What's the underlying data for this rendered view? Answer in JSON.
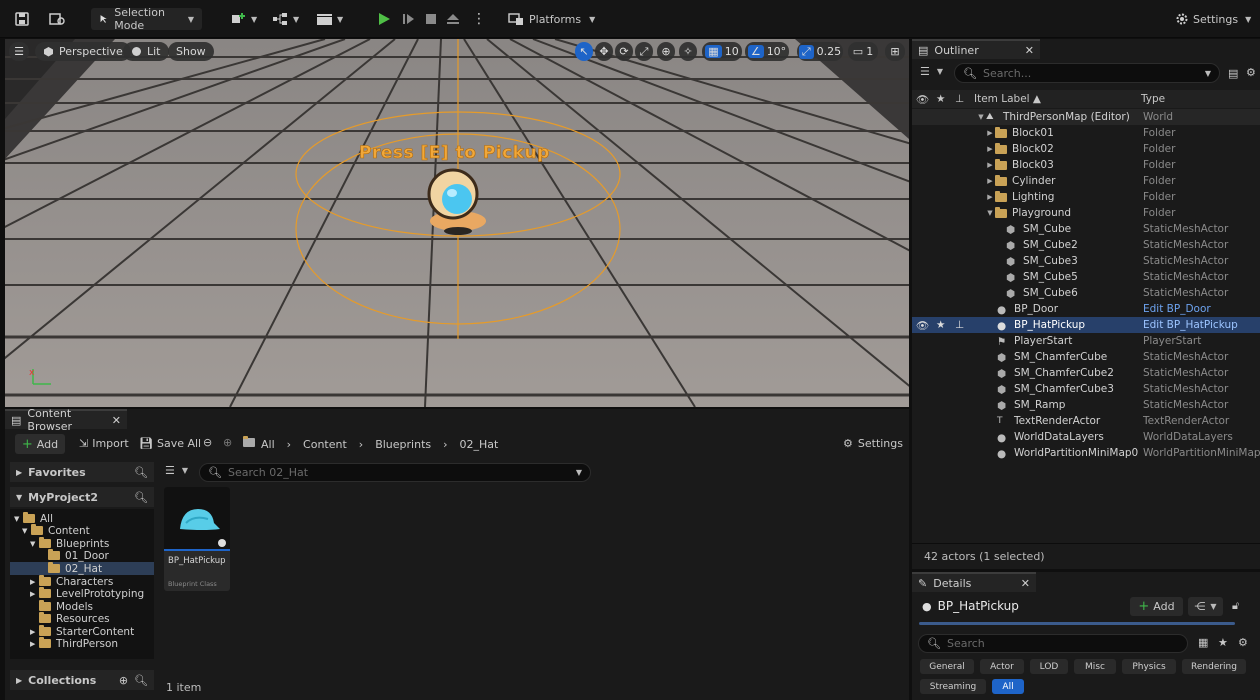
{
  "toolbar": {
    "selection_mode": "Selection Mode",
    "platforms": "Platforms",
    "settings": "Settings"
  },
  "viewport": {
    "perspective": "Perspective",
    "lit": "Lit",
    "show": "Show",
    "grid_snap": "10",
    "rot_snap": "10°",
    "scale_snap": "0.25",
    "camera_speed": "1",
    "world_text": "Press [E] to Pickup"
  },
  "outliner": {
    "tab": "Outliner",
    "search_placeholder": "Search...",
    "col_label": "Item Label",
    "col_type": "Type",
    "rows": [
      {
        "label": "ThirdPersonMap (Editor)",
        "type": "World"
      },
      {
        "label": "Block01",
        "type": "Folder"
      },
      {
        "label": "Block02",
        "type": "Folder"
      },
      {
        "label": "Block03",
        "type": "Folder"
      },
      {
        "label": "Cylinder",
        "type": "Folder"
      },
      {
        "label": "Lighting",
        "type": "Folder"
      },
      {
        "label": "Playground",
        "type": "Folder"
      },
      {
        "label": "SM_Cube",
        "type": "StaticMeshActor"
      },
      {
        "label": "SM_Cube2",
        "type": "StaticMeshActor"
      },
      {
        "label": "SM_Cube3",
        "type": "StaticMeshActor"
      },
      {
        "label": "SM_Cube5",
        "type": "StaticMeshActor"
      },
      {
        "label": "SM_Cube6",
        "type": "StaticMeshActor"
      },
      {
        "label": "BP_Door",
        "type": "Edit BP_Door"
      },
      {
        "label": "BP_HatPickup",
        "type": "Edit BP_HatPickup"
      },
      {
        "label": "PlayerStart",
        "type": "PlayerStart"
      },
      {
        "label": "SM_ChamferCube",
        "type": "StaticMeshActor"
      },
      {
        "label": "SM_ChamferCube2",
        "type": "StaticMeshActor"
      },
      {
        "label": "SM_ChamferCube3",
        "type": "StaticMeshActor"
      },
      {
        "label": "SM_Ramp",
        "type": "StaticMeshActor"
      },
      {
        "label": "TextRenderActor",
        "type": "TextRenderActor"
      },
      {
        "label": "WorldDataLayers",
        "type": "WorldDataLayers"
      },
      {
        "label": "WorldPartitionMiniMap0",
        "type": "WorldPartitionMiniMap"
      }
    ],
    "status": "42 actors (1 selected)"
  },
  "details": {
    "tab": "Details",
    "actor_name": "BP_HatPickup",
    "add": "Add",
    "search_placeholder": "Search",
    "chips": [
      "General",
      "Actor",
      "LOD",
      "Misc",
      "Physics",
      "Rendering",
      "Streaming",
      "All"
    ]
  },
  "content_browser": {
    "tab": "Content Browser",
    "add": "Add",
    "import": "Import",
    "save_all": "Save All",
    "breadcrumb": [
      "All",
      "Content",
      "Blueprints",
      "02_Hat"
    ],
    "settings": "Settings",
    "favorites": "Favorites",
    "project": "MyProject2",
    "search_placeholder": "Search 02_Hat",
    "tree": [
      "All",
      "Content",
      "Blueprints",
      "01_Door",
      "02_Hat",
      "Characters",
      "LevelPrototyping",
      "Models",
      "Resources",
      "StarterContent",
      "ThirdPerson"
    ],
    "collections": "Collections",
    "asset_name": "BP_HatPickup",
    "asset_type": "Blueprint Class",
    "item_count": "1 item"
  }
}
